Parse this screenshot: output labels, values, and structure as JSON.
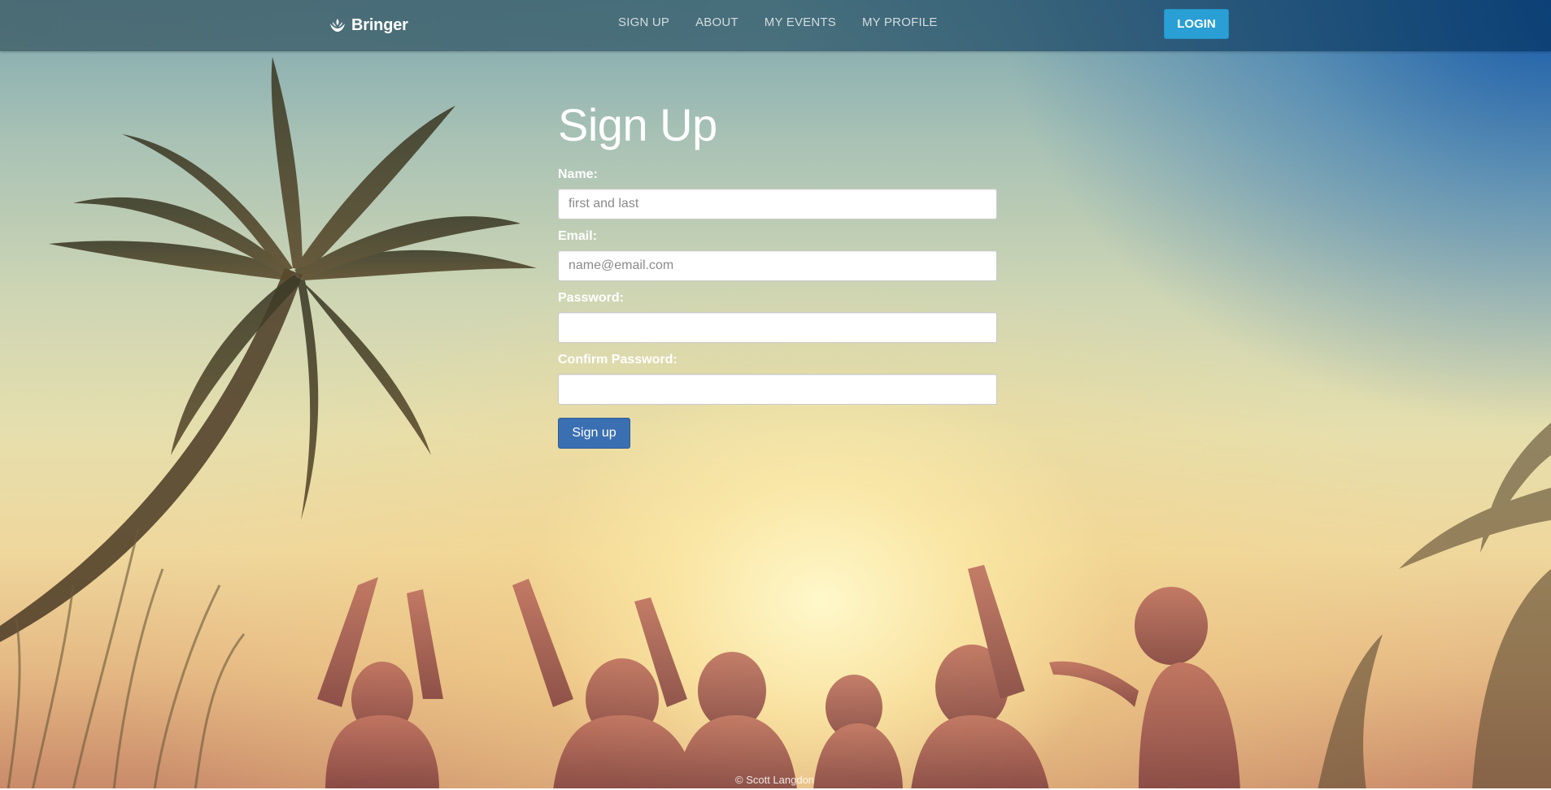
{
  "app": {
    "brand_name": "Bringer",
    "brand_icon": "lotus-hand-icon"
  },
  "nav": {
    "items": [
      {
        "label": "SIGN UP"
      },
      {
        "label": "ABOUT"
      },
      {
        "label": "MY EVENTS"
      },
      {
        "label": "MY PROFILE"
      }
    ],
    "login_label": "LOGIN"
  },
  "form": {
    "title": "Sign Up",
    "fields": [
      {
        "label": "Name:",
        "placeholder": "first and last",
        "value": ""
      },
      {
        "label": "Email:",
        "placeholder": "name@email.com",
        "value": ""
      },
      {
        "label": "Password:",
        "placeholder": "",
        "value": ""
      },
      {
        "label": "Confirm Password:",
        "placeholder": "",
        "value": ""
      }
    ],
    "submit_label": "Sign up"
  },
  "footer": {
    "credit": "© Scott Langdon"
  },
  "colors": {
    "login_button": "#2a9fd6",
    "submit_button": "#3a6fb2",
    "navbar_tint": "#3c5a64"
  }
}
